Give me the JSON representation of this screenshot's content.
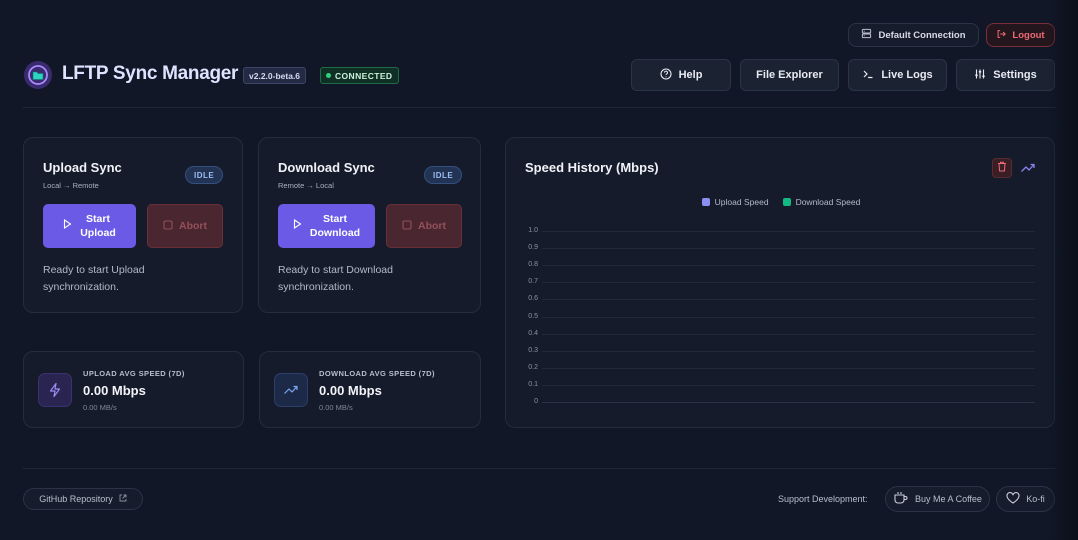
{
  "colors": {
    "accent": "#6a5ae6",
    "upload_series": "#8a90f0",
    "download_series": "#13b982",
    "connected": "#2fd17d",
    "logout": "#e2555f"
  },
  "header": {
    "app_title": "LFTP Sync Manager",
    "version": "v2.2.0-beta.6",
    "status": "CONNECTED",
    "connection_label": "Default Connection",
    "logout_label": "Logout",
    "nav": {
      "help": "Help",
      "file_explorer": "File Explorer",
      "live_logs": "Live Logs",
      "settings": "Settings"
    }
  },
  "upload": {
    "title": "Upload Sync",
    "direction": "Local → Remote",
    "badge": "IDLE",
    "start_line1": "Start",
    "start_line2": "Upload",
    "abort": "Abort",
    "message": "Ready to start Upload synchronization."
  },
  "download": {
    "title": "Download Sync",
    "direction": "Remote → Local",
    "badge": "IDLE",
    "start_line1": "Start",
    "start_line2": "Download",
    "abort": "Abort",
    "message": "Ready to start Download synchronization."
  },
  "stats": {
    "upload": {
      "label": "UPLOAD AVG SPEED (7D)",
      "value": "0.00 Mbps",
      "sub": "0.00 MB/s"
    },
    "download": {
      "label": "DOWNLOAD AVG SPEED (7D)",
      "value": "0.00 Mbps",
      "sub": "0.00 MB/s"
    }
  },
  "chart_data": {
    "type": "line",
    "title": "Speed History (Mbps)",
    "series": [
      {
        "name": "Upload Speed",
        "values": []
      },
      {
        "name": "Download Speed",
        "values": []
      }
    ],
    "y_ticks": [
      "1.0",
      "0.9",
      "0.8",
      "0.7",
      "0.6",
      "0.5",
      "0.4",
      "0.3",
      "0.2",
      "0.1",
      "0"
    ],
    "ylim": [
      0,
      1.0
    ],
    "grid": true,
    "legend_position": "top-center"
  },
  "footer": {
    "github": "GitHub Repository",
    "support_label": "Support Development:",
    "coffee": "Buy Me A Coffee",
    "kofi": "Ko-fi"
  }
}
